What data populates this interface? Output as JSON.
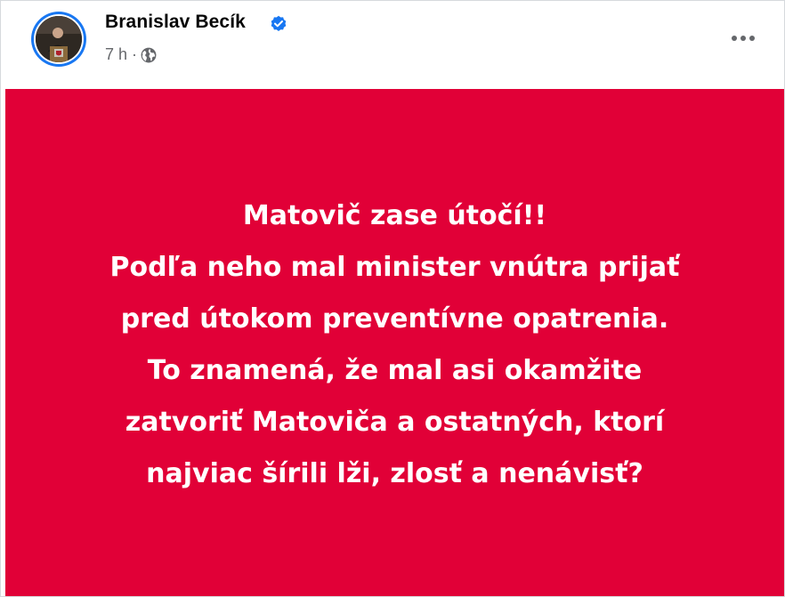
{
  "post": {
    "author": "Branislav Becík",
    "timestamp": "7 h",
    "separator": "·",
    "verified_icon": "verified-badge-icon",
    "audience_icon": "globe-icon",
    "menu_icon": "more-horizontal-icon",
    "image_text_lines": [
      "Matovič zase útočí!!",
      "Podľa neho mal minister vnútra prijať",
      "pred útokom preventívne opatrenia.",
      "To znamená, že mal asi okamžite",
      "zatvoriť Matoviča a ostatných, ktorí",
      "najviac šírili lži, zlosť a nenávisť?"
    ]
  },
  "colors": {
    "image_background": "#e10037",
    "image_text": "#ffffff",
    "verified_blue": "#1877f2",
    "secondary_text": "#65676b",
    "primary_text": "#050505"
  }
}
